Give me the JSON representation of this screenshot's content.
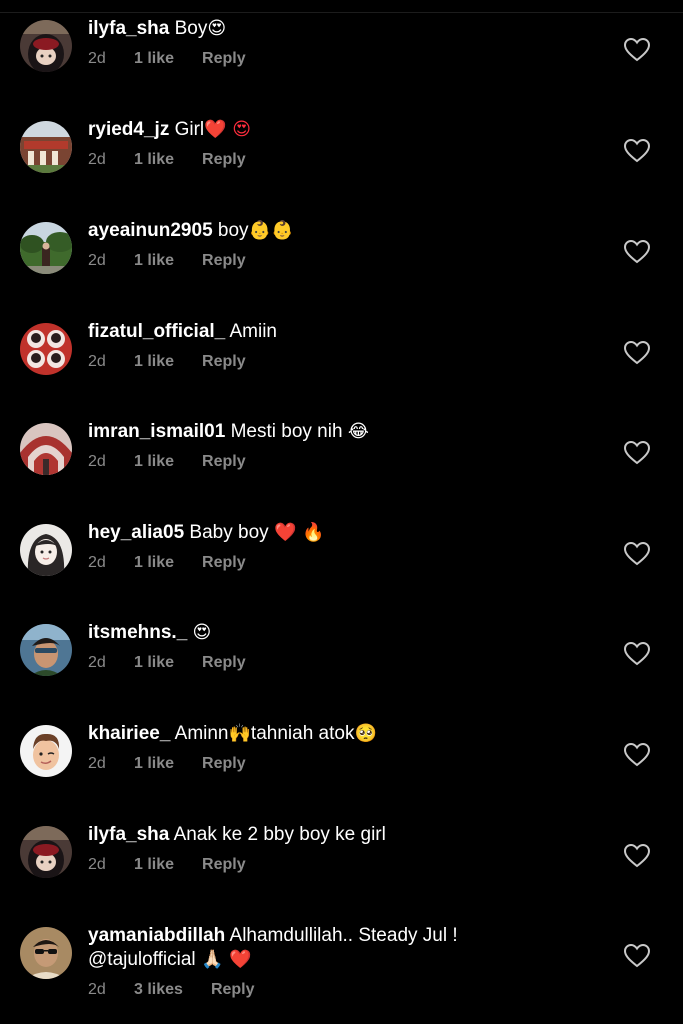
{
  "comments": [
    {
      "username": "ilyfa_sha",
      "text": "Boy",
      "emoji": "😍",
      "age": "2d",
      "likes": "1 like",
      "reply": "Reply",
      "avatar_icon": "hijab-girl-avatar",
      "avatar_bg": "#3a2c2a"
    },
    {
      "username": "ryied4_jz",
      "text": "Girl",
      "emoji": "❤️ 😍",
      "age": "2d",
      "likes": "1 like",
      "reply": "Reply",
      "avatar_icon": "building-photo-avatar",
      "avatar_bg": "#6b3b2f"
    },
    {
      "username": "ayeainun2905",
      "text": "boy",
      "emoji": "👶👶",
      "age": "2d",
      "likes": "1 like",
      "reply": "Reply",
      "avatar_icon": "outdoor-photo-avatar",
      "avatar_bg": "#4c6a3a"
    },
    {
      "username": "fizatul_official_",
      "text": "Amiin",
      "emoji": "",
      "age": "2d",
      "likes": "1 like",
      "reply": "Reply",
      "avatar_icon": "couple-circles-avatar",
      "avatar_bg": "#c0322b"
    },
    {
      "username": "imran_ismail01",
      "text": "Mesti boy nih",
      "emoji": "😂",
      "age": "2d",
      "likes": "1 like",
      "reply": "Reply",
      "avatar_icon": "red-arches-avatar",
      "avatar_bg": "#8e2b2b"
    },
    {
      "username": "hey_alia05",
      "text": "Baby boy",
      "emoji": "❤️ 🔥",
      "age": "2d",
      "likes": "1 like",
      "reply": "Reply",
      "avatar_icon": "cartoon-girl-avatar",
      "avatar_bg": "#e8e6e3"
    },
    {
      "username": "itsmehns._",
      "text": "",
      "emoji": "😍",
      "age": "2d",
      "likes": "1 like",
      "reply": "Reply",
      "avatar_icon": "selfie-photo-avatar",
      "avatar_bg": "#3d5d7a"
    },
    {
      "username": "khairiee_",
      "text": "Aminn",
      "text2": "tahniah atok",
      "emoji": "🙌",
      "emoji2": "🥺",
      "age": "2d",
      "likes": "1 like",
      "reply": "Reply",
      "avatar_icon": "memoji-avatar",
      "avatar_bg": "#f4f4f4"
    },
    {
      "username": "ilyfa_sha",
      "text": "Anak ke 2 bby boy ke girl",
      "emoji": "",
      "age": "2d",
      "likes": "1 like",
      "reply": "Reply",
      "avatar_icon": "hijab-girl-avatar",
      "avatar_bg": "#3a2c2a"
    },
    {
      "username": "yamaniabdillah",
      "text": "Alhamdullilah.. Steady Jul !",
      "mention": "@tajulofficial",
      "emoji": "🙏🏻 ❤️",
      "age": "2d",
      "likes": "3 likes",
      "reply": "Reply",
      "avatar_icon": "sunglasses-man-avatar",
      "avatar_bg": "#8a6a45"
    }
  ],
  "colors": {
    "background": "#000000",
    "text": "#ffffff",
    "meta": "#8a8a8a",
    "heart_outline": "#c8c8c8"
  }
}
